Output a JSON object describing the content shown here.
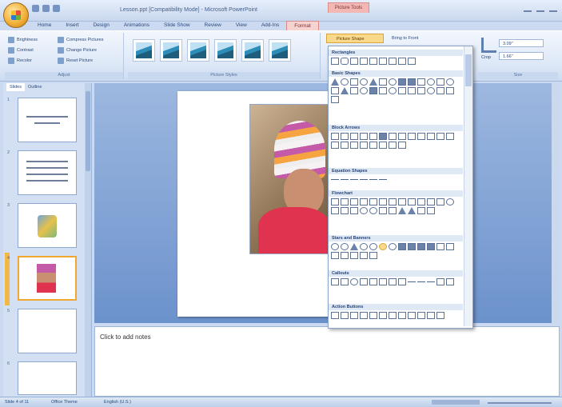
{
  "titlebar": {
    "window_title": "Lesson.ppt [Compatibility Mode] - Microsoft PowerPoint",
    "context_label": "Picture Tools"
  },
  "tabs": [
    "Home",
    "Insert",
    "Design",
    "Animations",
    "Slide Show",
    "Review",
    "View",
    "Add-Ins",
    "Format"
  ],
  "ribbon": {
    "adjust": {
      "items": [
        "Brightness",
        "Contrast",
        "Recolor",
        "Compress Pictures",
        "Change Picture",
        "Reset Picture"
      ],
      "label": "Adjust"
    },
    "styles": {
      "label": "Picture Styles"
    },
    "picture_shape_label": "Picture Shape",
    "bring_front_label": "Bring to Front",
    "size": {
      "crop_label": "Crop",
      "height": "3.09\"",
      "width": "1.66\"",
      "label": "Size"
    }
  },
  "left_pane": {
    "tabs": [
      "Slides",
      "Outline"
    ],
    "slide_numbers": [
      "1",
      "2",
      "3",
      "4",
      "5",
      "6"
    ]
  },
  "notes": {
    "placeholder": "Click to add notes"
  },
  "status": {
    "slide": "Slide 4 of 11",
    "theme": "Office Theme",
    "language": "English (U.S.)"
  },
  "shapes_menu": {
    "sections": [
      "Rectangles",
      "Basic Shapes",
      "Block Arrows",
      "Equation Shapes",
      "Flowchart",
      "Stars and Banners",
      "Callouts",
      "Action Buttons"
    ]
  }
}
